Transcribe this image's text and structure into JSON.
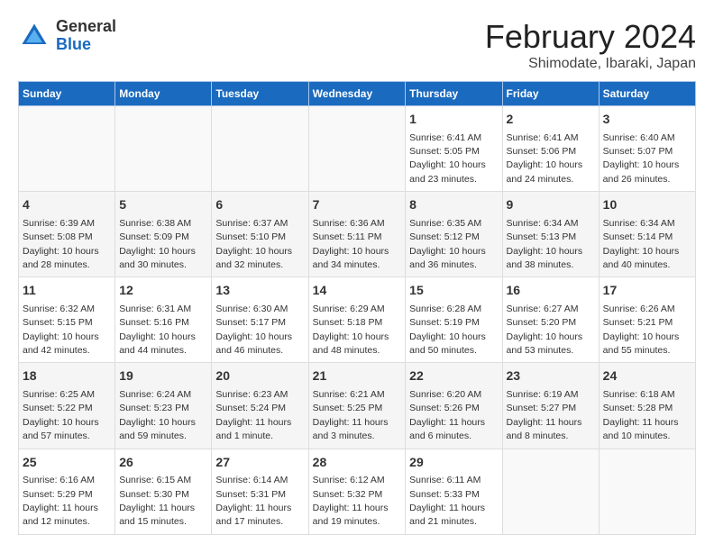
{
  "header": {
    "logo_general": "General",
    "logo_blue": "Blue",
    "month_title": "February 2024",
    "location": "Shimodate, Ibaraki, Japan"
  },
  "days_of_week": [
    "Sunday",
    "Monday",
    "Tuesday",
    "Wednesday",
    "Thursday",
    "Friday",
    "Saturday"
  ],
  "weeks": [
    [
      {
        "day": "",
        "info": ""
      },
      {
        "day": "",
        "info": ""
      },
      {
        "day": "",
        "info": ""
      },
      {
        "day": "",
        "info": ""
      },
      {
        "day": "1",
        "info": "Sunrise: 6:41 AM\nSunset: 5:05 PM\nDaylight: 10 hours and 23 minutes."
      },
      {
        "day": "2",
        "info": "Sunrise: 6:41 AM\nSunset: 5:06 PM\nDaylight: 10 hours and 24 minutes."
      },
      {
        "day": "3",
        "info": "Sunrise: 6:40 AM\nSunset: 5:07 PM\nDaylight: 10 hours and 26 minutes."
      }
    ],
    [
      {
        "day": "4",
        "info": "Sunrise: 6:39 AM\nSunset: 5:08 PM\nDaylight: 10 hours and 28 minutes."
      },
      {
        "day": "5",
        "info": "Sunrise: 6:38 AM\nSunset: 5:09 PM\nDaylight: 10 hours and 30 minutes."
      },
      {
        "day": "6",
        "info": "Sunrise: 6:37 AM\nSunset: 5:10 PM\nDaylight: 10 hours and 32 minutes."
      },
      {
        "day": "7",
        "info": "Sunrise: 6:36 AM\nSunset: 5:11 PM\nDaylight: 10 hours and 34 minutes."
      },
      {
        "day": "8",
        "info": "Sunrise: 6:35 AM\nSunset: 5:12 PM\nDaylight: 10 hours and 36 minutes."
      },
      {
        "day": "9",
        "info": "Sunrise: 6:34 AM\nSunset: 5:13 PM\nDaylight: 10 hours and 38 minutes."
      },
      {
        "day": "10",
        "info": "Sunrise: 6:34 AM\nSunset: 5:14 PM\nDaylight: 10 hours and 40 minutes."
      }
    ],
    [
      {
        "day": "11",
        "info": "Sunrise: 6:32 AM\nSunset: 5:15 PM\nDaylight: 10 hours and 42 minutes."
      },
      {
        "day": "12",
        "info": "Sunrise: 6:31 AM\nSunset: 5:16 PM\nDaylight: 10 hours and 44 minutes."
      },
      {
        "day": "13",
        "info": "Sunrise: 6:30 AM\nSunset: 5:17 PM\nDaylight: 10 hours and 46 minutes."
      },
      {
        "day": "14",
        "info": "Sunrise: 6:29 AM\nSunset: 5:18 PM\nDaylight: 10 hours and 48 minutes."
      },
      {
        "day": "15",
        "info": "Sunrise: 6:28 AM\nSunset: 5:19 PM\nDaylight: 10 hours and 50 minutes."
      },
      {
        "day": "16",
        "info": "Sunrise: 6:27 AM\nSunset: 5:20 PM\nDaylight: 10 hours and 53 minutes."
      },
      {
        "day": "17",
        "info": "Sunrise: 6:26 AM\nSunset: 5:21 PM\nDaylight: 10 hours and 55 minutes."
      }
    ],
    [
      {
        "day": "18",
        "info": "Sunrise: 6:25 AM\nSunset: 5:22 PM\nDaylight: 10 hours and 57 minutes."
      },
      {
        "day": "19",
        "info": "Sunrise: 6:24 AM\nSunset: 5:23 PM\nDaylight: 10 hours and 59 minutes."
      },
      {
        "day": "20",
        "info": "Sunrise: 6:23 AM\nSunset: 5:24 PM\nDaylight: 11 hours and 1 minute."
      },
      {
        "day": "21",
        "info": "Sunrise: 6:21 AM\nSunset: 5:25 PM\nDaylight: 11 hours and 3 minutes."
      },
      {
        "day": "22",
        "info": "Sunrise: 6:20 AM\nSunset: 5:26 PM\nDaylight: 11 hours and 6 minutes."
      },
      {
        "day": "23",
        "info": "Sunrise: 6:19 AM\nSunset: 5:27 PM\nDaylight: 11 hours and 8 minutes."
      },
      {
        "day": "24",
        "info": "Sunrise: 6:18 AM\nSunset: 5:28 PM\nDaylight: 11 hours and 10 minutes."
      }
    ],
    [
      {
        "day": "25",
        "info": "Sunrise: 6:16 AM\nSunset: 5:29 PM\nDaylight: 11 hours and 12 minutes."
      },
      {
        "day": "26",
        "info": "Sunrise: 6:15 AM\nSunset: 5:30 PM\nDaylight: 11 hours and 15 minutes."
      },
      {
        "day": "27",
        "info": "Sunrise: 6:14 AM\nSunset: 5:31 PM\nDaylight: 11 hours and 17 minutes."
      },
      {
        "day": "28",
        "info": "Sunrise: 6:12 AM\nSunset: 5:32 PM\nDaylight: 11 hours and 19 minutes."
      },
      {
        "day": "29",
        "info": "Sunrise: 6:11 AM\nSunset: 5:33 PM\nDaylight: 11 hours and 21 minutes."
      },
      {
        "day": "",
        "info": ""
      },
      {
        "day": "",
        "info": ""
      }
    ]
  ]
}
